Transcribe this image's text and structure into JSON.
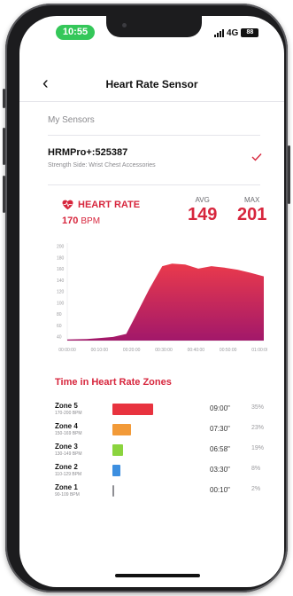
{
  "status_bar": {
    "time": "10:55",
    "network": "4G",
    "battery": "88"
  },
  "nav": {
    "title": "Heart Rate Sensor"
  },
  "sensors": {
    "section_label": "My Sensors",
    "items": [
      {
        "name": "HRMPro+:525387",
        "subtitle": "Strength Side: Wrist Chest Accessories",
        "selected": true
      }
    ]
  },
  "heart_rate": {
    "label": "HEART RATE",
    "current_value": "170",
    "current_unit": "BPM",
    "avg_label": "AVG",
    "avg_value": "149",
    "max_label": "MAX",
    "max_value": "201"
  },
  "chart_data": {
    "type": "area",
    "title": "",
    "xlabel": "",
    "ylabel": "",
    "y_ticks": [
      "200",
      "180",
      "160",
      "140",
      "120",
      "100",
      "80",
      "60",
      "40"
    ],
    "x_ticks": [
      "00:00:00",
      "00:10:00",
      "00:20:00",
      "00:30:00",
      "00:40:00",
      "00:50:00",
      "01:00:00"
    ],
    "ylim": [
      30,
      220
    ],
    "xlim": [
      0,
      60
    ],
    "series": [
      {
        "x": [
          0,
          6,
          10,
          14,
          18,
          21,
          25,
          29,
          32,
          36,
          40,
          44,
          48,
          52,
          56,
          60
        ],
        "values": [
          32,
          33,
          35,
          37,
          43,
          80,
          130,
          175,
          180,
          178,
          170,
          175,
          172,
          168,
          162,
          155
        ]
      }
    ],
    "grid": false,
    "colors": {
      "gradient_top": "#ea3a4c",
      "gradient_bottom": "#a2186a"
    }
  },
  "zones": {
    "title": "Time in Heart Rate Zones",
    "items": [
      {
        "name": "Zone 5",
        "range": "170-200 BPM",
        "time": "09:00\"",
        "percent": "35%",
        "fraction": 1.0,
        "color": "#e8333f"
      },
      {
        "name": "Zone 4",
        "range": "150-169 BPM",
        "time": "07:30\"",
        "percent": "23%",
        "fraction": 0.46,
        "color": "#f29a38"
      },
      {
        "name": "Zone 3",
        "range": "130-149 BPM",
        "time": "06:58\"",
        "percent": "19%",
        "fraction": 0.27,
        "color": "#8bd43e"
      },
      {
        "name": "Zone 2",
        "range": "110-129 BPM",
        "time": "03:30\"",
        "percent": "8%",
        "fraction": 0.19,
        "color": "#3d8fe0"
      },
      {
        "name": "Zone 1",
        "range": "90-109 BPM",
        "time": "00:10\"",
        "percent": "2%",
        "fraction": 0.05,
        "color": "#8e8e93"
      }
    ]
  }
}
